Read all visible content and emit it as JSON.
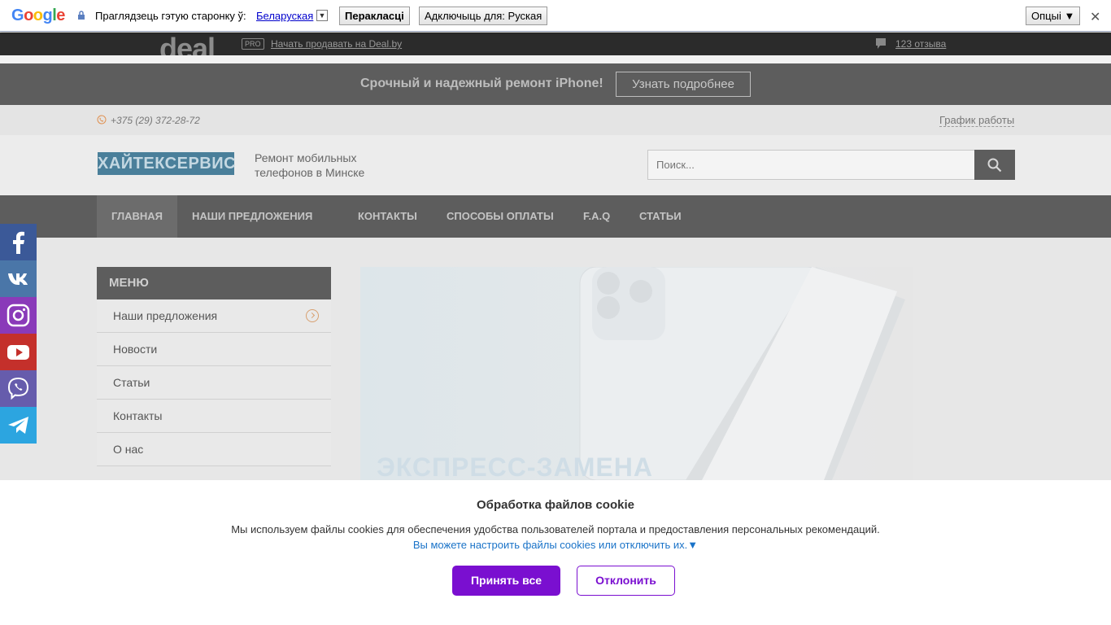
{
  "translate_bar": {
    "logo": "Google",
    "prompt": "Праглядзець гэтую старонку ў:",
    "language": "Беларуская",
    "language_arrow": "▼",
    "translate_label": "Перакласці",
    "always_label": "Адключыць для: Руская",
    "options_label": "Опцыі ▼",
    "close": "✕"
  },
  "deal_bar": {
    "logo": "deal",
    "pro_badge": "PRO",
    "sell_link": "Начать продавать на Deal.by",
    "reviews_link": "123 отзыва"
  },
  "promo": {
    "text": "Срочный и надежный ремонт iPhone!",
    "button": "Узнать подробнее"
  },
  "contact": {
    "phone": "+375 (29) 372-28-72",
    "schedule": "График работы"
  },
  "header": {
    "logo_text": "ХАЙТЕКСЕРВИС",
    "tagline": "Ремонт мобильных телефонов в Минске",
    "search_placeholder": "Поиск..."
  },
  "nav": {
    "items": [
      {
        "label": "ГЛАВНАЯ"
      },
      {
        "label": "НАШИ ПРЕДЛОЖЕНИЯ"
      },
      {
        "label": "КОНТАКТЫ"
      },
      {
        "label": "СПОСОБЫ ОПЛАТЫ"
      },
      {
        "label": "F.A.Q"
      },
      {
        "label": "СТАТЬИ"
      }
    ]
  },
  "sidebar": {
    "title": "МЕНЮ",
    "items": [
      {
        "label": "Наши предложения"
      },
      {
        "label": "Новости"
      },
      {
        "label": "Статьи"
      },
      {
        "label": "Контакты"
      },
      {
        "label": "О нас"
      }
    ]
  },
  "hero": {
    "text": "ЭКСПРЕСС-ЗАМЕНА"
  },
  "social": {
    "colors": {
      "facebook": "#3b5998",
      "vk": "#4a76a8",
      "instagram": "#8a3ab9",
      "youtube": "#c4302b",
      "viber": "#665cac",
      "telegram": "#2ca5e0"
    }
  },
  "cookie": {
    "title": "Обработка файлов cookie",
    "text": "Мы используем файлы cookies для обеспечения удобства пользователей портала и предоставления персональных рекомендаций.",
    "link": "Вы можете настроить файлы cookies или отключить их.▼",
    "accept": "Принять все",
    "reject": "Отклонить",
    "accent": "#7a0fd0"
  }
}
